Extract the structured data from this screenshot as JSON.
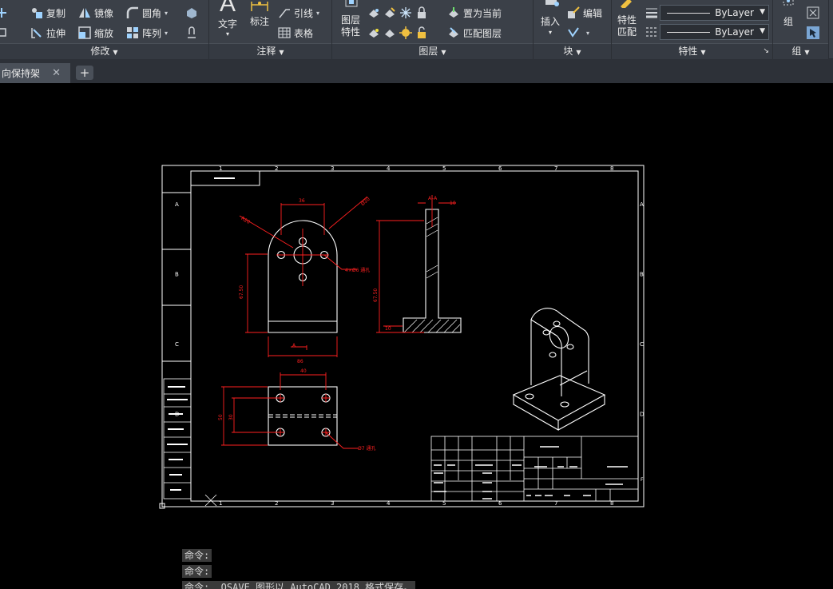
{
  "ribbon": {
    "modify": {
      "title": "修改",
      "copy": "复制",
      "mirror": "镜像",
      "fillet": "圆角",
      "stretch": "拉伸",
      "scale": "缩放",
      "array": "阵列"
    },
    "annotation": {
      "title": "注释",
      "text": "文字",
      "dimension": "标注",
      "leader": "引线",
      "table": "表格"
    },
    "layers": {
      "title": "图层",
      "layer_properties_line1": "图层",
      "layer_properties_line2": "特性",
      "set_current": "置为当前",
      "match_layer": "匹配图层"
    },
    "block": {
      "title": "块",
      "insert": "插入",
      "edit": "编辑"
    },
    "properties": {
      "title": "特性",
      "match_properties_line1": "特性",
      "match_properties_line2": "匹配",
      "linetype_value": "ByLayer",
      "lineweight_value": "ByLayer"
    },
    "groups": {
      "title": "组",
      "group": "组"
    }
  },
  "tabs": {
    "document_tab": "向保持架",
    "close_glyph": "✕",
    "new_tab_glyph": "+"
  },
  "drawing": {
    "views": [
      "front-view",
      "side-section-view",
      "top-view",
      "isometric-view"
    ],
    "zone_letters": [
      "A",
      "B",
      "C",
      "D"
    ],
    "zone_numbers": [
      "1",
      "2",
      "3",
      "4",
      "5",
      "6",
      "7",
      "8"
    ],
    "title_block_mark": "F"
  },
  "command_line": {
    "lines": [
      "命令:",
      "命令:",
      "命令:  _QSAVE 图形以 AutoCAD 2018 格式保存。"
    ]
  },
  "colors": {
    "ribbon_bg": "#3b4048",
    "dimension_red": "#ff2020",
    "geometry_white": "#ffffff",
    "canvas_bg": "#000000"
  }
}
